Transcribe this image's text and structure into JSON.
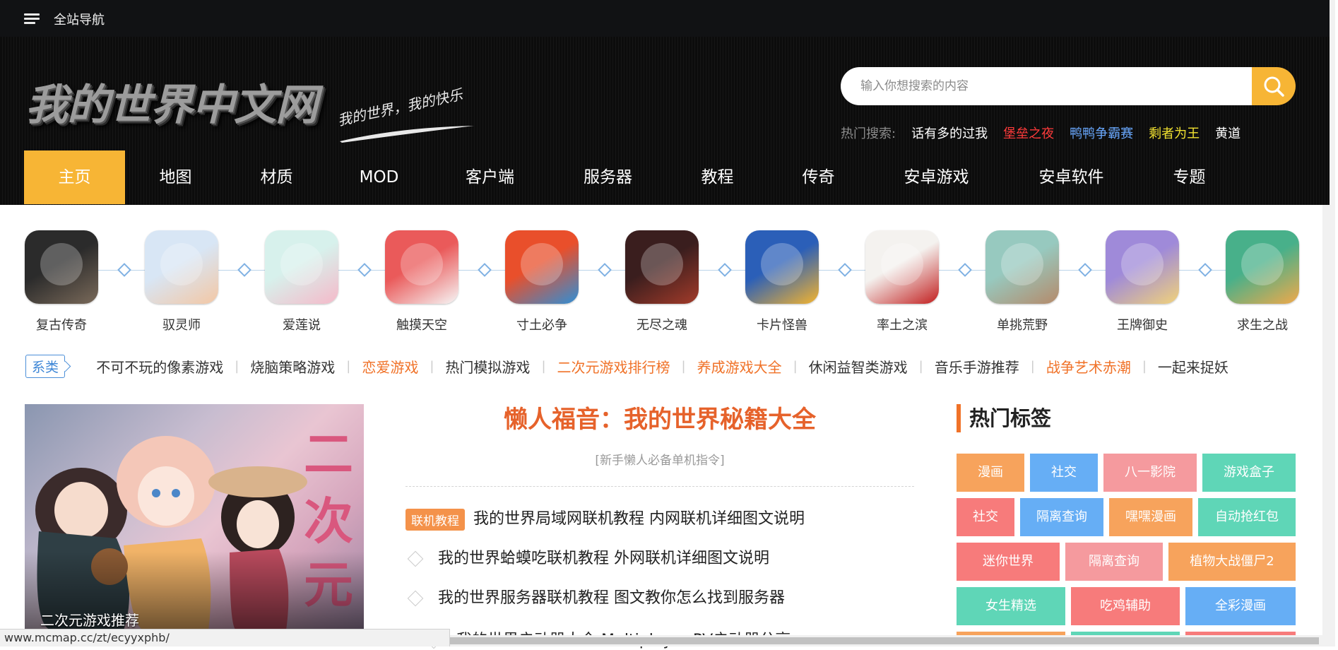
{
  "topbar": {
    "nav_label": "全站导航"
  },
  "header": {
    "logo_text": "我的世界中文网",
    "slogan": "我的世界，我的快乐",
    "search_placeholder": "输入你想搜索的内容",
    "hot_search_label": "热门搜索:",
    "hot_search": [
      {
        "text": "话有多的过我",
        "color": "#ffffff"
      },
      {
        "text": "堡垒之夜",
        "color": "#ff3b3b"
      },
      {
        "text": "鸭鸭争霸赛",
        "color": "#6aa9ff"
      },
      {
        "text": "剩者为王",
        "color": "#f2e230"
      },
      {
        "text": "黄道",
        "color": "#ffffff"
      }
    ]
  },
  "nav": [
    "主页",
    "地图",
    "材质",
    "MOD",
    "客户端",
    "服务器",
    "教程",
    "传奇",
    "安卓游戏",
    "安卓软件",
    "专题"
  ],
  "games": [
    {
      "name": "复古传奇",
      "icon": "game-fugu-chuanqi-icon"
    },
    {
      "name": "驭灵师",
      "icon": "game-yulingshi-icon"
    },
    {
      "name": "爱莲说",
      "icon": "game-ailianshuo-icon"
    },
    {
      "name": "触摸天空",
      "icon": "game-chumo-tiankong-icon"
    },
    {
      "name": "寸土必争",
      "icon": "game-cuntu-bizheng-icon"
    },
    {
      "name": "无尽之魂",
      "icon": "game-wujin-zhihun-icon"
    },
    {
      "name": "卡片怪兽",
      "icon": "game-kapian-guaishou-icon"
    },
    {
      "name": "率土之滨",
      "icon": "game-shuaitu-zhibin-icon"
    },
    {
      "name": "单挑荒野",
      "icon": "game-dantiao-huangye-icon"
    },
    {
      "name": "王牌御史",
      "icon": "game-wangpai-yushi-icon"
    },
    {
      "name": "求生之战",
      "icon": "game-qiusheng-zhizhan-icon"
    }
  ],
  "categories": {
    "badge": "系类",
    "items": [
      {
        "text": "不可不玩的像素游戏",
        "highlight": false
      },
      {
        "text": "烧脑策略游戏",
        "highlight": false
      },
      {
        "text": "恋爱游戏",
        "highlight": true
      },
      {
        "text": "热门模拟游戏",
        "highlight": false
      },
      {
        "text": "二次元游戏排行榜",
        "highlight": true
      },
      {
        "text": "养成游戏大全",
        "highlight": true
      },
      {
        "text": "休闲益智类游戏",
        "highlight": false
      },
      {
        "text": "音乐手游推荐",
        "highlight": false
      },
      {
        "text": "战争艺术赤潮",
        "highlight": true
      },
      {
        "text": "一起来捉妖",
        "highlight": false
      }
    ]
  },
  "feature": {
    "caption": "二次元游戏推荐",
    "art_text": "二次元"
  },
  "article": {
    "title": "懒人福音：我的世界秘籍大全",
    "subtitle": "[新手懒人必备单机指令]",
    "tag": "联机教程",
    "rows": [
      "我的世界局域网联机教程 内网联机详细图文说明",
      "我的世界蛤蟆吃联机教程 外网联机详细图文说明",
      "我的世界服务器联机教程 图文教你怎么找到服务器",
      "我的世界启动器大全 Multiplayer PV启动器分享"
    ]
  },
  "hot_tags": {
    "title": "热门标签",
    "rows": [
      [
        {
          "text": "漫画",
          "color": "#f7a35c"
        },
        {
          "text": "社交",
          "color": "#66aef5"
        },
        {
          "text": "八一影院",
          "color": "#f59a9e"
        },
        {
          "text": "游戏盒子",
          "color": "#5fd6b7"
        }
      ],
      [
        {
          "text": "社交",
          "color": "#f77b7b"
        },
        {
          "text": "隔离查询",
          "color": "#66aef5"
        },
        {
          "text": "嘿嘿漫画",
          "color": "#f7a35c"
        },
        {
          "text": "自动抢红包",
          "color": "#5fd6b7"
        }
      ],
      [
        {
          "text": "迷你世界",
          "color": "#f77b7b"
        },
        {
          "text": "隔离查询",
          "color": "#f59a9e"
        },
        {
          "text": "植物大战僵尸2",
          "color": "#f7a35c"
        }
      ],
      [
        {
          "text": "女生精选",
          "color": "#5fd6b7"
        },
        {
          "text": "吃鸡辅助",
          "color": "#f77b7b"
        },
        {
          "text": "全彩漫画",
          "color": "#66aef5"
        }
      ]
    ]
  },
  "statusbar": {
    "url": "www.mcmap.cc/zt/ecyyxphb/"
  },
  "colors": {
    "accent": "#f7b535",
    "title_orange": "#e6622b",
    "category_orange": "#f07228",
    "header_bg": "#0f0f0f"
  }
}
